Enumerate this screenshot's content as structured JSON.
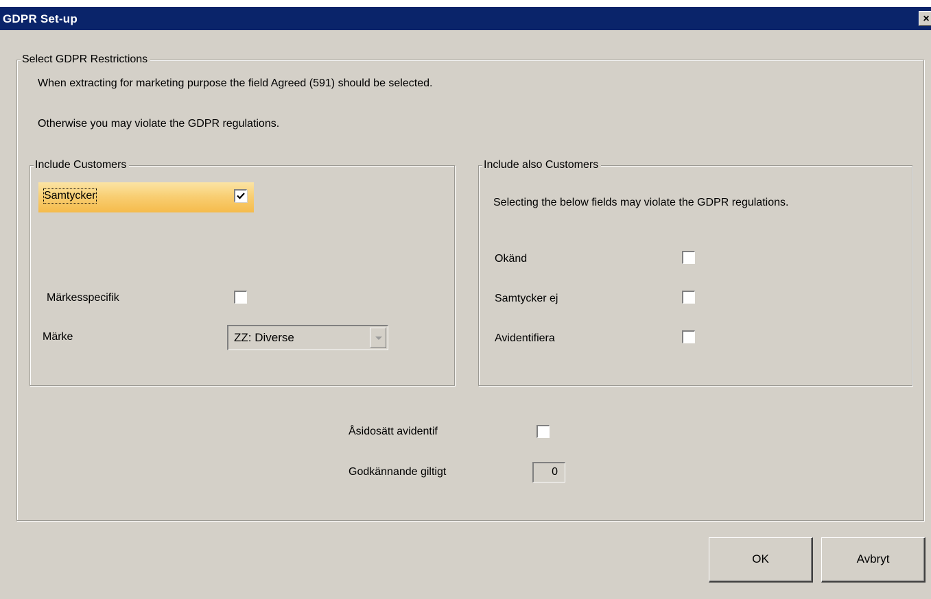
{
  "window": {
    "title": "GDPR Set-up",
    "close_glyph": "×"
  },
  "restrictions": {
    "legend": "Select GDPR Restrictions",
    "info_line1": "When extracting for marketing purpose the field Agreed (591) should be selected.",
    "info_line2": "Otherwise you may violate the GDPR regulations."
  },
  "include_customers": {
    "legend": "Include Customers",
    "samtycker": {
      "label": "Samtycker",
      "checked": true
    },
    "markesspecifik": {
      "label": "Märkesspecifik",
      "checked": false
    },
    "marke": {
      "label": "Märke",
      "value": "ZZ: Diverse"
    }
  },
  "include_also": {
    "legend": "Include also Customers",
    "warning": "Selecting the below fields may violate the GDPR regulations.",
    "okand": {
      "label": "Okänd",
      "checked": false
    },
    "samtycker_ej": {
      "label": "Samtycker ej",
      "checked": false
    },
    "avidentifiera": {
      "label": "Avidentifiera",
      "checked": false
    }
  },
  "asidosatt": {
    "label": "Åsidosätt avidentif",
    "checked": false
  },
  "godkannande": {
    "label": "Godkännande giltigt",
    "value": "0"
  },
  "buttons": {
    "ok": "OK",
    "cancel": "Avbryt"
  }
}
